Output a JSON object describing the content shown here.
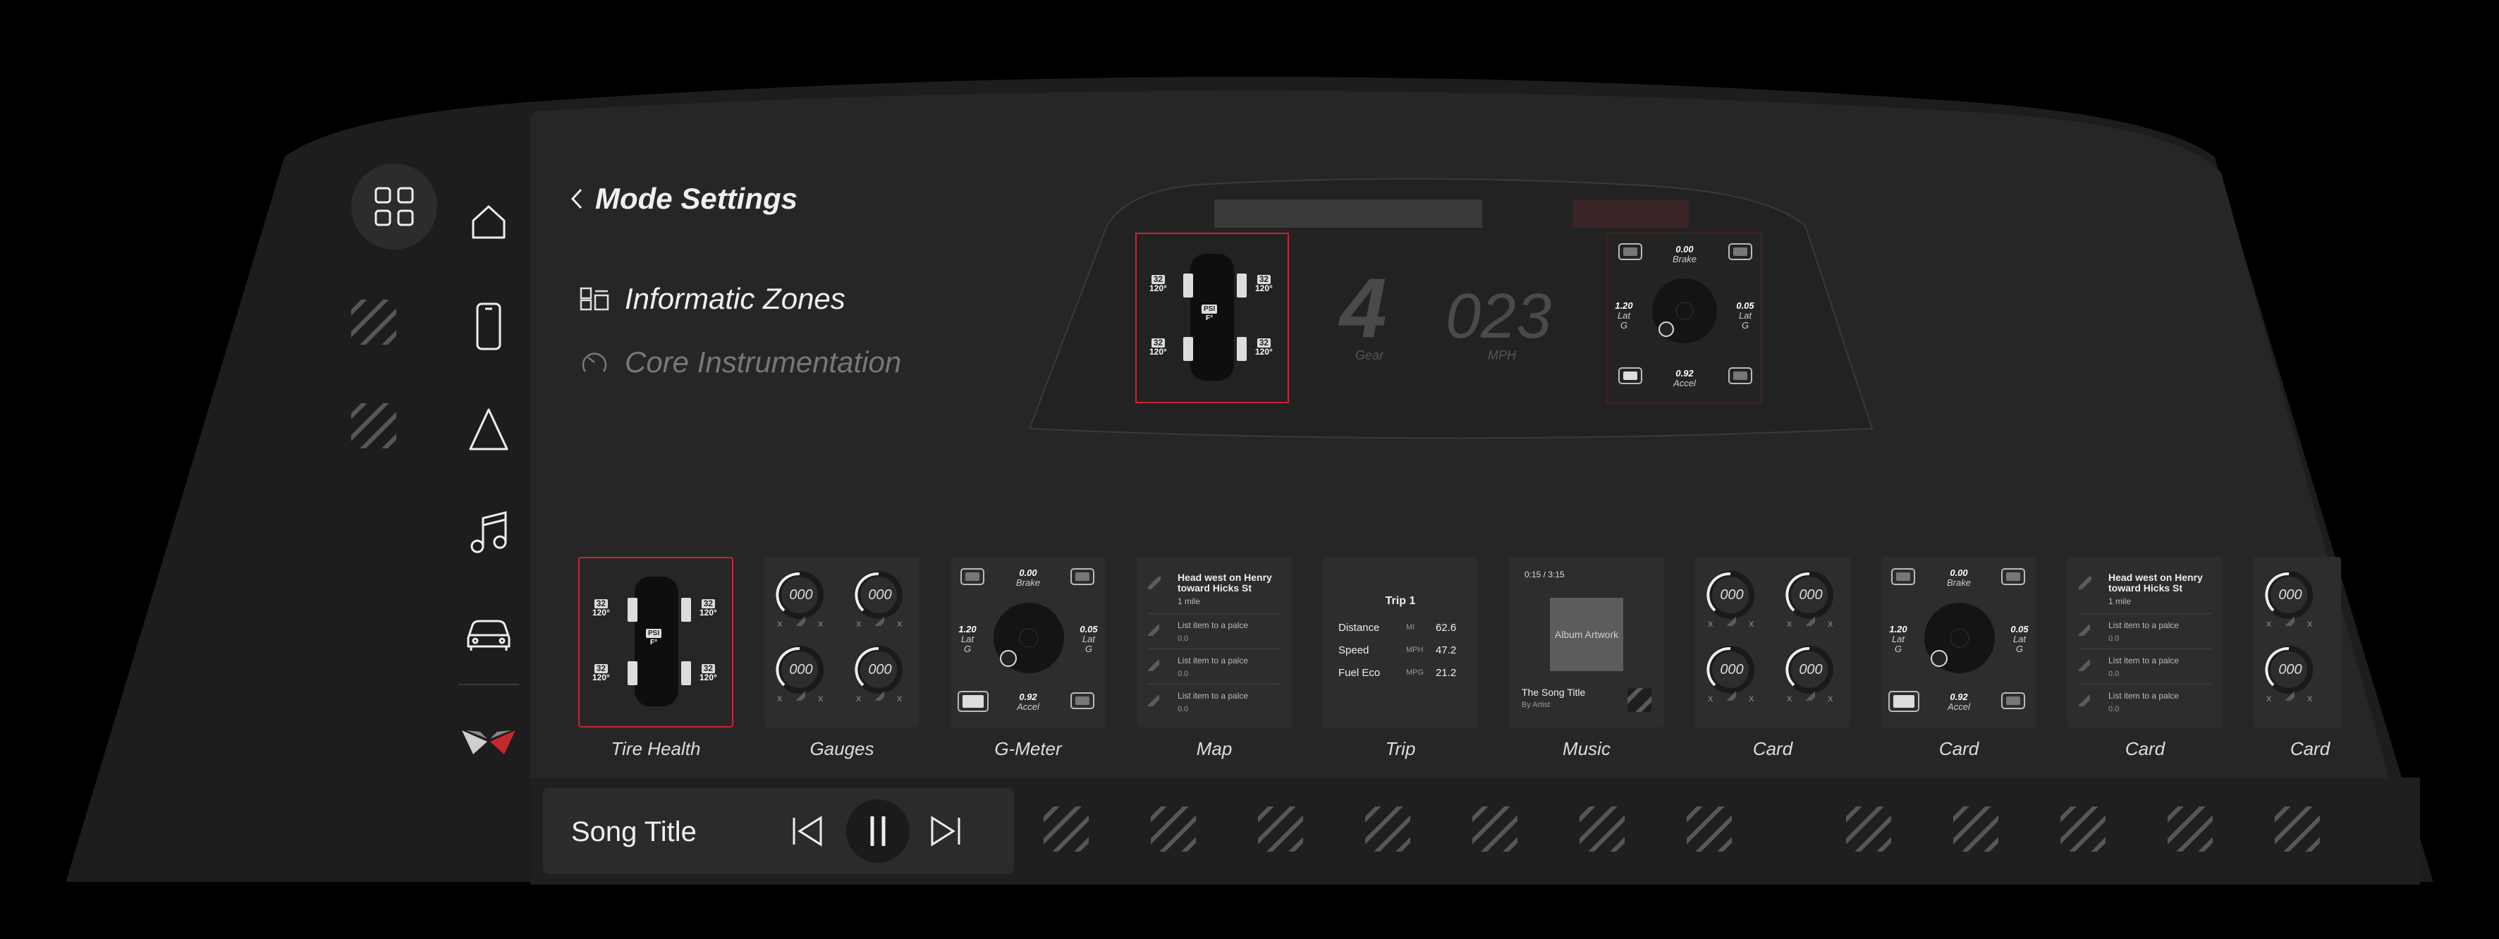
{
  "header": {
    "back_label": "Mode Settings"
  },
  "settings_menu": {
    "items": [
      {
        "label": "Informatic Zones",
        "icon": "zones-icon",
        "active": true
      },
      {
        "label": "Core Instrumentation",
        "icon": "gauge-icon",
        "active": false
      }
    ]
  },
  "nav": {
    "items": [
      "apps-grid-icon",
      "home-icon",
      "phone-icon",
      "navigation-icon",
      "music-icon",
      "car-icon",
      "corvette-logo"
    ]
  },
  "cluster": {
    "gear": "4",
    "gear_label": "Gear",
    "speed": "023",
    "speed_label": "MPH",
    "tire_widget": {
      "pressure": "32",
      "temp": "120°",
      "unit": "PSI",
      "unit2": "F°"
    },
    "gmeter": {
      "brake": "0.00",
      "brake_label": "Brake",
      "lat_left": "1.20",
      "lat_right": "0.05",
      "lat_label": "Lat",
      "g_label": "G",
      "accel": "0.92",
      "accel_label": "Accel"
    }
  },
  "cards": [
    {
      "label": "Tire Health",
      "type": "tire"
    },
    {
      "label": "Gauges",
      "type": "gauges"
    },
    {
      "label": "G-Meter",
      "type": "gmeter"
    },
    {
      "label": "Map",
      "type": "map"
    },
    {
      "label": "Trip",
      "type": "trip"
    },
    {
      "label": "Music",
      "type": "music"
    },
    {
      "label": "Card",
      "type": "gauges"
    },
    {
      "label": "Card",
      "type": "gmeter"
    },
    {
      "label": "Card",
      "type": "map"
    },
    {
      "label": "Card",
      "type": "gauges"
    }
  ],
  "gauge_value": "000",
  "gauge_x": "X",
  "map_card": {
    "heading": "Head west on Henry toward Hicks St",
    "distance": "1 mile",
    "items": [
      {
        "text": "List item to a palce",
        "value": "0.0"
      },
      {
        "text": "List item to a palce",
        "value": "0.0"
      },
      {
        "text": "List item to a palce",
        "value": "0.0"
      }
    ]
  },
  "trip_card": {
    "title": "Trip 1",
    "rows": [
      {
        "label": "Distance",
        "unit": "MI",
        "value": "62.6"
      },
      {
        "label": "Speed",
        "unit": "MPH",
        "value": "47.2"
      },
      {
        "label": "Fuel Eco",
        "unit": "MPG",
        "value": "21.2"
      }
    ]
  },
  "music_card": {
    "time": "0:15 / 3:15",
    "artwork": "Album Artwork",
    "title": "The Song Title",
    "artist": "By Artist"
  },
  "player": {
    "song_title": "Song Title"
  },
  "colors": {
    "accent_red": "#c8262f",
    "panel": "#262626",
    "background": "#000000"
  }
}
